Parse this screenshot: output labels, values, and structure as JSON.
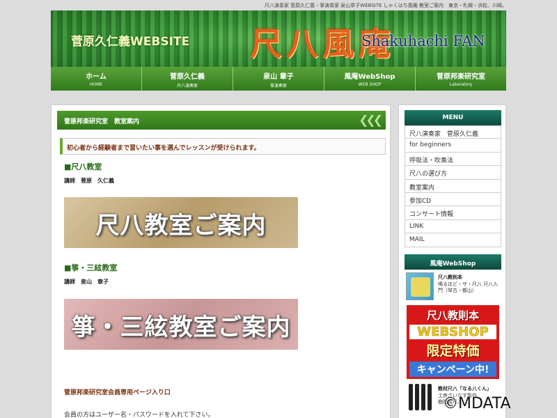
{
  "topline": "尺八演奏家 菅原久仁義・箏演奏家 泉山章子WEBSITE しゃくはち風庵 教室ご案内　東京・札幌・浜松、川崎。",
  "header": {
    "name": "菅原久仁義WEBSITE",
    "logo": "尺八風庵",
    "subtitle": "Shakuhachi FAN"
  },
  "nav": [
    {
      "jp": "ホーム",
      "en": "HOME"
    },
    {
      "jp": "菅原久仁義",
      "en": "尺八演奏家"
    },
    {
      "jp": "泉山 章子",
      "en": "箏演奏家"
    },
    {
      "jp": "風庵WebShop",
      "en": "WEB SHOP"
    },
    {
      "jp": "菅原邦楽研究室",
      "en": "Laboratory"
    }
  ],
  "main": {
    "breadcrumb": "菅原邦楽研究室　教室案内",
    "notice": "初心者から経験者まで習いたい事を選んでレッスンが受けられます。",
    "sections": [
      {
        "title": "■尺八教室",
        "teacher": "講師　菅原　久仁義",
        "banner": "尺八教室ご案内"
      },
      {
        "title": "■箏・三絃教室",
        "teacher": "講師　泉山　章子",
        "banner": "箏・三絃教室ご案内"
      }
    ],
    "members_link": "菅原邦楽研究室会員専用ページ入り口",
    "login_note": "会員の方はユーザー名・パスワードを入れて下さい。"
  },
  "sidebar": {
    "menu_title": "MENU",
    "menu": [
      "尺八演奏家　菅原久仁義",
      "for beginners",
      "呼吸法・吹奏法",
      "尺八の選び方",
      "教室案内",
      "参加CD",
      "コンサート情報",
      "LINK",
      "MAIL"
    ],
    "shop_title": "風庵WebShop",
    "shop_item": {
      "title": "尺八教則本",
      "desc": "鳴るほど・ザ・尺八 尺八入門（琴古・都山）"
    },
    "promo": {
      "l1": "尺八教則本",
      "l2": "WEBSHOP",
      "l3": "限定特価",
      "l4": "キャンペーン中!"
    },
    "kit": {
      "title": "教材尺八「なる八くん」",
      "desc1": "工房さいなす製作",
      "desc2": "樹脂製尺八"
    }
  },
  "watermark": "©MDATA",
  "colors": {
    "nav_green": "#3f8a22",
    "menu_teal": "#0e4a3e",
    "accent_brown": "#7a3010",
    "section_green": "#2a6a1a"
  }
}
